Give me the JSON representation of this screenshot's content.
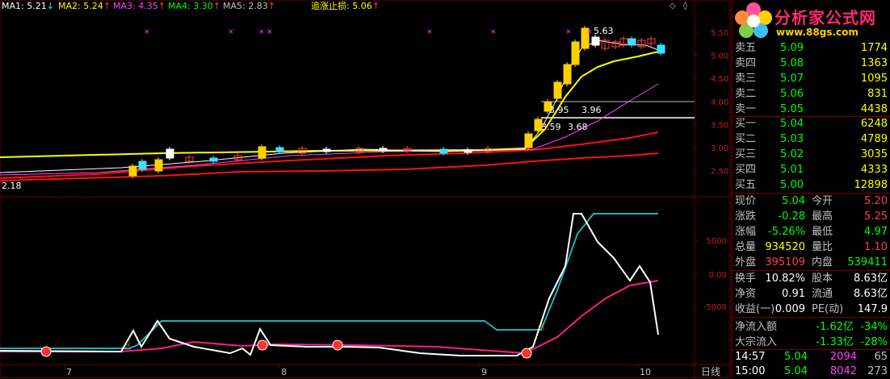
{
  "ma_legend": [
    {
      "label": "MA1: 5.21",
      "arrow": "↓",
      "color": "#ffffff"
    },
    {
      "label": "MA2: 5.24",
      "arrow": "↑",
      "color": "#ffff00"
    },
    {
      "label": "MA3: 4.35",
      "arrow": "↑",
      "color": "#ff40ff"
    },
    {
      "label": "MA4: 3.30",
      "arrow": "↑",
      "color": "#00ff00"
    },
    {
      "label": "MA5: 2.83",
      "arrow": "↑",
      "color": "#c0c0c0"
    }
  ],
  "stop_loss": {
    "label": "追涨止损: 5.06",
    "arrow": "↑",
    "color": "#ffff00"
  },
  "price_axis": [
    "5.50",
    "5.00",
    "4.50",
    "4.00",
    "3.50",
    "3.00",
    "2.50"
  ],
  "indicator_axis": [
    "5000",
    "0.00",
    "-5000"
  ],
  "date_axis": [
    "7",
    "8",
    "9",
    "10"
  ],
  "period_label": "日线",
  "annotations": {
    "high": "5.63",
    "low": "2.18",
    "mid1a": "3.95",
    "mid1b": "3.96",
    "mid2a": "3.59",
    "mid2b": "3.68"
  },
  "logo": {
    "title": "分析家公式网",
    "url": "www.88gs.com"
  },
  "order_book": {
    "asks": [
      {
        "label": "卖五",
        "price": "5.09",
        "vol": "1774"
      },
      {
        "label": "卖四",
        "price": "5.08",
        "vol": "1363"
      },
      {
        "label": "卖三",
        "price": "5.07",
        "vol": "1095"
      },
      {
        "label": "卖二",
        "price": "5.06",
        "vol": "831"
      },
      {
        "label": "卖一",
        "price": "5.05",
        "vol": "4438"
      }
    ],
    "bids": [
      {
        "label": "买一",
        "price": "5.04",
        "vol": "6248"
      },
      {
        "label": "买二",
        "price": "5.03",
        "vol": "4789"
      },
      {
        "label": "买三",
        "price": "5.02",
        "vol": "3035"
      },
      {
        "label": "买四",
        "price": "5.01",
        "vol": "4333"
      },
      {
        "label": "买五",
        "price": "5.00",
        "vol": "12898"
      }
    ]
  },
  "quote": [
    {
      "l1": "现价",
      "v1": "5.04",
      "c1": "#00ff00",
      "l2": "今开",
      "v2": "5.20",
      "c2": "#ff4040"
    },
    {
      "l1": "涨跌",
      "v1": "-0.28",
      "c1": "#00ff00",
      "l2": "最高",
      "v2": "5.25",
      "c2": "#ff4040"
    },
    {
      "l1": "涨幅",
      "v1": "-5.26%",
      "c1": "#00ff00",
      "l2": "最低",
      "v2": "4.97",
      "c2": "#00ff00"
    },
    {
      "l1": "总量",
      "v1": "934520",
      "c1": "#ffff00",
      "l2": "量比",
      "v2": "1.10",
      "c2": "#ff4040"
    },
    {
      "l1": "外盘",
      "v1": "395109",
      "c1": "#ff4040",
      "l2": "内盘",
      "v2": "539411",
      "c2": "#00ff00"
    }
  ],
  "fund": [
    {
      "l1": "换手",
      "v1": "10.82%",
      "l2": "股本",
      "v2": "8.63亿"
    },
    {
      "l1": "净资",
      "v1": "0.91",
      "l2": "流通",
      "v2": "8.63亿"
    },
    {
      "l1": "收益(一)",
      "v1": "0.009",
      "l2": "PE(动)",
      "v2": "147.9"
    }
  ],
  "flow": [
    {
      "label": "净流入额",
      "amount": "-1.62亿",
      "pct": "-34%"
    },
    {
      "label": "大宗流入",
      "amount": "-1.33亿",
      "pct": "-28%"
    }
  ],
  "ticks": [
    {
      "time": "14:57",
      "price": "5.04",
      "vol": "2094",
      "count": "65"
    },
    {
      "time": "15:00",
      "price": "5.04",
      "vol": "8042",
      "count": "273"
    }
  ]
}
